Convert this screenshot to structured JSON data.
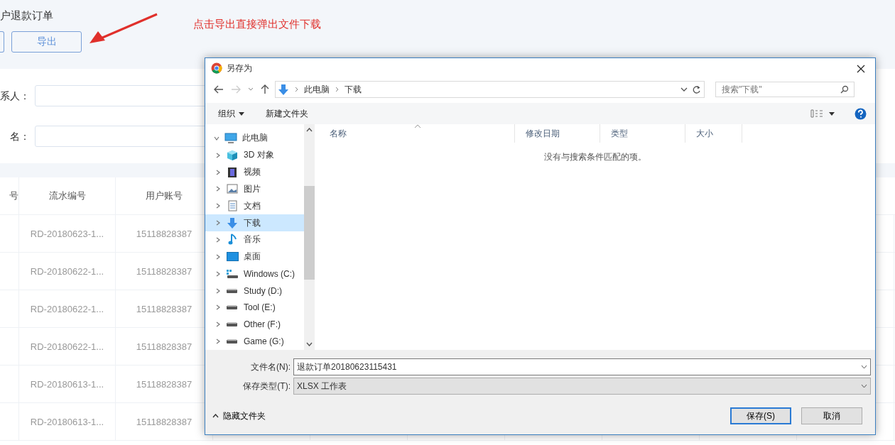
{
  "page": {
    "title": "户退款订单",
    "export_button": "导出",
    "annotation": "点击导出直接弹出文件下载",
    "form": [
      {
        "label": "系人："
      },
      {
        "label": "名："
      }
    ],
    "table": {
      "columns": [
        "号",
        "流水编号",
        "用户账号"
      ],
      "rows": [
        {
          "serial": "RD-20180623-1...",
          "account": "15118828387"
        },
        {
          "serial": "RD-20180622-1...",
          "account": "15118828387"
        },
        {
          "serial": "RD-20180622-1...",
          "account": "15118828387"
        },
        {
          "serial": "RD-20180622-1...",
          "account": "15118828387"
        },
        {
          "serial": "RD-20180613-1...",
          "account": "15118828387"
        },
        {
          "serial": "RD-20180613-1...",
          "account": "15118828387"
        }
      ]
    }
  },
  "dialog": {
    "title": "另存为",
    "address_path": [
      "此电脑",
      "下载"
    ],
    "search": {
      "placeholder": "搜索\"下载\""
    },
    "toolbar": {
      "organize": "组织",
      "new_folder": "新建文件夹"
    },
    "tree": [
      {
        "label": "此电脑",
        "kind": "computer",
        "expanded": true,
        "selected": false,
        "children": [
          {
            "label": "3D 对象",
            "kind": "cube",
            "expanded": false,
            "selected": false
          },
          {
            "label": "视频",
            "kind": "video",
            "expanded": false,
            "selected": false
          },
          {
            "label": "图片",
            "kind": "picture",
            "expanded": false,
            "selected": false
          },
          {
            "label": "文档",
            "kind": "document",
            "expanded": false,
            "selected": false
          },
          {
            "label": "下载",
            "kind": "download",
            "expanded": false,
            "selected": true
          },
          {
            "label": "音乐",
            "kind": "music",
            "expanded": false,
            "selected": false
          },
          {
            "label": "桌面",
            "kind": "desktop",
            "expanded": false,
            "selected": false
          },
          {
            "label": "Windows (C:)",
            "kind": "system-drive",
            "expanded": false,
            "selected": false
          },
          {
            "label": "Study (D:)",
            "kind": "drive",
            "expanded": false,
            "selected": false
          },
          {
            "label": "Tool (E:)",
            "kind": "drive",
            "expanded": false,
            "selected": false
          },
          {
            "label": "Other (F:)",
            "kind": "drive",
            "expanded": false,
            "selected": false
          },
          {
            "label": "Game (G:)",
            "kind": "drive",
            "expanded": false,
            "selected": false
          }
        ]
      }
    ],
    "columns": [
      "名称",
      "修改日期",
      "类型",
      "大小"
    ],
    "empty_message": "没有与搜索条件匹配的项。",
    "file_name": {
      "label": "文件名(N):",
      "value": "退款订单20180623115431"
    },
    "file_type": {
      "label": "保存类型(T):",
      "value": "XLSX 工作表"
    },
    "hide_folders": "隐藏文件夹",
    "save": "保存(S)",
    "cancel": "取消"
  }
}
